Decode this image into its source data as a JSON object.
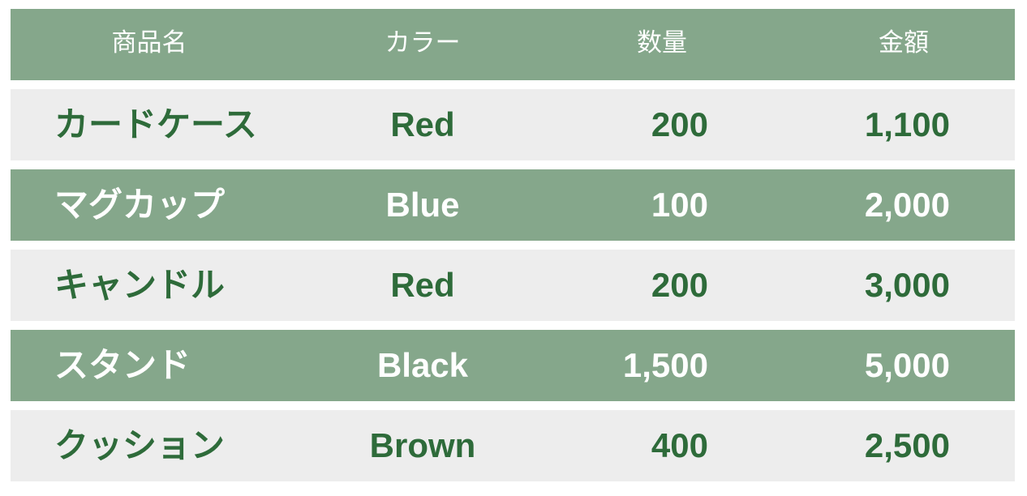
{
  "colors": {
    "header_bg": "#85a78b",
    "row_dark_bg": "#85a78b",
    "row_light_bg": "#ededed",
    "text_green": "#2e6b3a",
    "text_white": "#ffffff"
  },
  "table": {
    "headers": [
      "商品名",
      "カラー",
      "数量",
      "金額"
    ],
    "rows": [
      {
        "name": "カードケース",
        "color": "Red",
        "quantity": "200",
        "amount": "1,100",
        "style": "light"
      },
      {
        "name": "マグカップ",
        "color": "Blue",
        "quantity": "100",
        "amount": "2,000",
        "style": "dark"
      },
      {
        "name": "キャンドル",
        "color": "Red",
        "quantity": "200",
        "amount": "3,000",
        "style": "light"
      },
      {
        "name": "スタンド",
        "color": "Black",
        "quantity": "1,500",
        "amount": "5,000",
        "style": "dark"
      },
      {
        "name": "クッション",
        "color": "Brown",
        "quantity": "400",
        "amount": "2,500",
        "style": "light"
      }
    ]
  }
}
